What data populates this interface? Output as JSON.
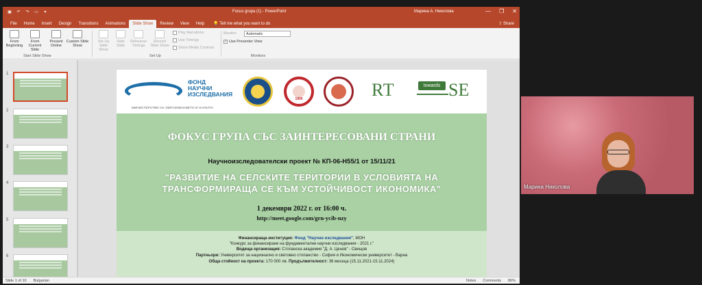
{
  "titlebar": {
    "doc_title": "Focus grupa (1)  -  PowerPoint",
    "user": "Марина А. Николова",
    "min": "—",
    "max": "❐",
    "close": "✕"
  },
  "menu": {
    "tabs": [
      "File",
      "Home",
      "Insert",
      "Design",
      "Transitions",
      "Animations",
      "Slide Show",
      "Review",
      "View",
      "Help"
    ],
    "active": "Slide Show",
    "tell_me": "Tell me what you want to do",
    "share": "Share"
  },
  "ribbon": {
    "from_beginning": "From Beginning",
    "from_current": "From Current Slide",
    "present_online": "Present Online",
    "custom_slide_show": "Custom Slide Show",
    "group_start": "Start Slide Show",
    "set_up": "Set Up Slide Show",
    "hide_slide": "Hide Slide",
    "rehearse": "Rehearse Timings",
    "record": "Record Slide Show",
    "play_narrations": "Play Narrations",
    "use_timings": "Use Timings",
    "show_media": "Show Media Controls",
    "group_setup": "Set Up",
    "monitor_label": "Monitor:",
    "monitor_value": "Automatic",
    "presenter_view": "Use Presenter View",
    "group_monitors": "Monitors"
  },
  "thumbnails": [
    "1",
    "2",
    "3",
    "4",
    "5",
    "6"
  ],
  "slide": {
    "fni_line1": "ФОНД",
    "fni_line2": "НАУЧНИ",
    "fni_line3": "ИЗСЛЕДВАНИЯ",
    "fni_sub": "МИНИСТЕРСТВО НА ОБРАЗОВАНИЕТО И НАУКАТА",
    "seal2_year": "1900",
    "rt": "RT",
    "towards": "towards",
    "se": "SE",
    "title": "ФОКУС ГРУПА СЪС ЗАИНТЕРЕСОВАНИ СТРАНИ",
    "project": "Научноизследователски проект № КП-06-Н55/1 от 15/11/21",
    "quote_line1": "\"РАЗВИТИЕ НА СЕЛСКИТЕ ТЕРИТОРИИ В УСЛОВИЯТА НА",
    "quote_line2": "ТРАНСФОРМИРАЩА СЕ  КЪМ УСТОЙЧИВОСТ ИКОНОМИКА\"",
    "date": "1 декември 2022 г. от 16:00 ч.",
    "link": "http://meet.google.com/grn-ycib-nzy",
    "fin_label": "Финансираща институция:",
    "fin_value": "Фонд \"Научни изследвания\"",
    "fin_suffix": ", МОН",
    "contest": "\"Конкурс за финансиране на фундаментални научни изследвания - 2021 г.\"",
    "lead_label": "Водеща организация:",
    "lead_value": "Стопанска академия \"Д. А. Ценов\" - Свищов",
    "partners_label": "Партньори:",
    "partners_value": "Университет за национално и световно стопанство - София и Икономически университет - Варна",
    "cost_label": "Обща стойност на проекта:",
    "cost_value": "170 000 лв.",
    "duration_label": "Продължителност:",
    "duration_value": "36 месеца (15.11.2021-15.11.2024)"
  },
  "status": {
    "slide": "Slide 1 of 10",
    "lang": "Bulgarian",
    "notes": "Notes",
    "comments": "Comments",
    "zoom": "86%"
  },
  "video": {
    "name": "Марина Николова"
  },
  "colors": {
    "accent": "#b7472a",
    "slide_green": "#a9d1a4"
  }
}
